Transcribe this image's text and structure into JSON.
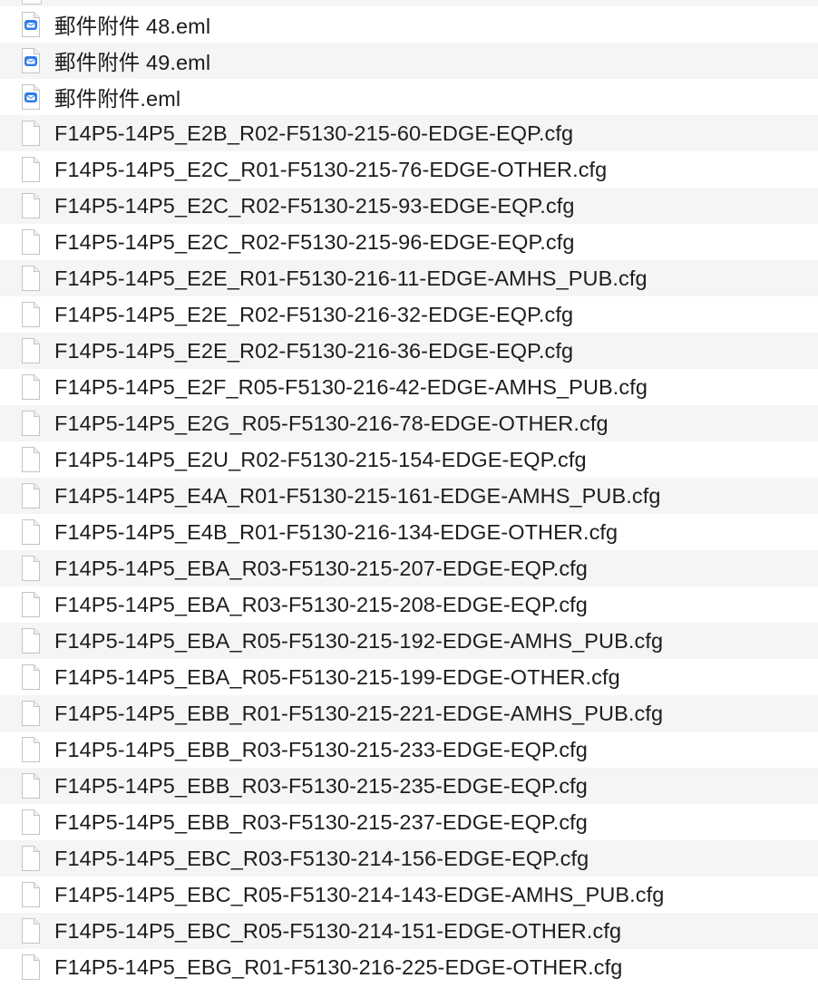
{
  "file_list": {
    "files": [
      {
        "name": "郵件附件 48.eml",
        "icon": "email-document-icon"
      },
      {
        "name": "郵件附件 49.eml",
        "icon": "email-document-icon"
      },
      {
        "name": "郵件附件.eml",
        "icon": "email-document-icon"
      },
      {
        "name": "F14P5-14P5_E2B_R02-F5130-215-60-EDGE-EQP.cfg",
        "icon": "generic-document-icon"
      },
      {
        "name": "F14P5-14P5_E2C_R01-F5130-215-76-EDGE-OTHER.cfg",
        "icon": "generic-document-icon"
      },
      {
        "name": "F14P5-14P5_E2C_R02-F5130-215-93-EDGE-EQP.cfg",
        "icon": "generic-document-icon"
      },
      {
        "name": "F14P5-14P5_E2C_R02-F5130-215-96-EDGE-EQP.cfg",
        "icon": "generic-document-icon"
      },
      {
        "name": "F14P5-14P5_E2E_R01-F5130-216-11-EDGE-AMHS_PUB.cfg",
        "icon": "generic-document-icon"
      },
      {
        "name": "F14P5-14P5_E2E_R02-F5130-216-32-EDGE-EQP.cfg",
        "icon": "generic-document-icon"
      },
      {
        "name": "F14P5-14P5_E2E_R02-F5130-216-36-EDGE-EQP.cfg",
        "icon": "generic-document-icon"
      },
      {
        "name": "F14P5-14P5_E2F_R05-F5130-216-42-EDGE-AMHS_PUB.cfg",
        "icon": "generic-document-icon"
      },
      {
        "name": "F14P5-14P5_E2G_R05-F5130-216-78-EDGE-OTHER.cfg",
        "icon": "generic-document-icon"
      },
      {
        "name": "F14P5-14P5_E2U_R02-F5130-215-154-EDGE-EQP.cfg",
        "icon": "generic-document-icon"
      },
      {
        "name": "F14P5-14P5_E4A_R01-F5130-215-161-EDGE-AMHS_PUB.cfg",
        "icon": "generic-document-icon"
      },
      {
        "name": "F14P5-14P5_E4B_R01-F5130-216-134-EDGE-OTHER.cfg",
        "icon": "generic-document-icon"
      },
      {
        "name": "F14P5-14P5_EBA_R03-F5130-215-207-EDGE-EQP.cfg",
        "icon": "generic-document-icon"
      },
      {
        "name": "F14P5-14P5_EBA_R03-F5130-215-208-EDGE-EQP.cfg",
        "icon": "generic-document-icon"
      },
      {
        "name": "F14P5-14P5_EBA_R05-F5130-215-192-EDGE-AMHS_PUB.cfg",
        "icon": "generic-document-icon"
      },
      {
        "name": "F14P5-14P5_EBA_R05-F5130-215-199-EDGE-OTHER.cfg",
        "icon": "generic-document-icon"
      },
      {
        "name": "F14P5-14P5_EBB_R01-F5130-215-221-EDGE-AMHS_PUB.cfg",
        "icon": "generic-document-icon"
      },
      {
        "name": "F14P5-14P5_EBB_R03-F5130-215-233-EDGE-EQP.cfg",
        "icon": "generic-document-icon"
      },
      {
        "name": "F14P5-14P5_EBB_R03-F5130-215-235-EDGE-EQP.cfg",
        "icon": "generic-document-icon"
      },
      {
        "name": "F14P5-14P5_EBB_R03-F5130-215-237-EDGE-EQP.cfg",
        "icon": "generic-document-icon"
      },
      {
        "name": "F14P5-14P5_EBC_R03-F5130-214-156-EDGE-EQP.cfg",
        "icon": "generic-document-icon"
      },
      {
        "name": "F14P5-14P5_EBC_R05-F5130-214-143-EDGE-AMHS_PUB.cfg",
        "icon": "generic-document-icon"
      },
      {
        "name": "F14P5-14P5_EBC_R05-F5130-214-151-EDGE-OTHER.cfg",
        "icon": "generic-document-icon"
      },
      {
        "name": "F14P5-14P5_EBG_R01-F5130-216-225-EDGE-OTHER.cfg",
        "icon": "generic-document-icon"
      }
    ]
  },
  "colors": {
    "row_alternate": "#f4f5f5",
    "text": "#1d1d1f",
    "email_badge": "#2f7be6"
  }
}
